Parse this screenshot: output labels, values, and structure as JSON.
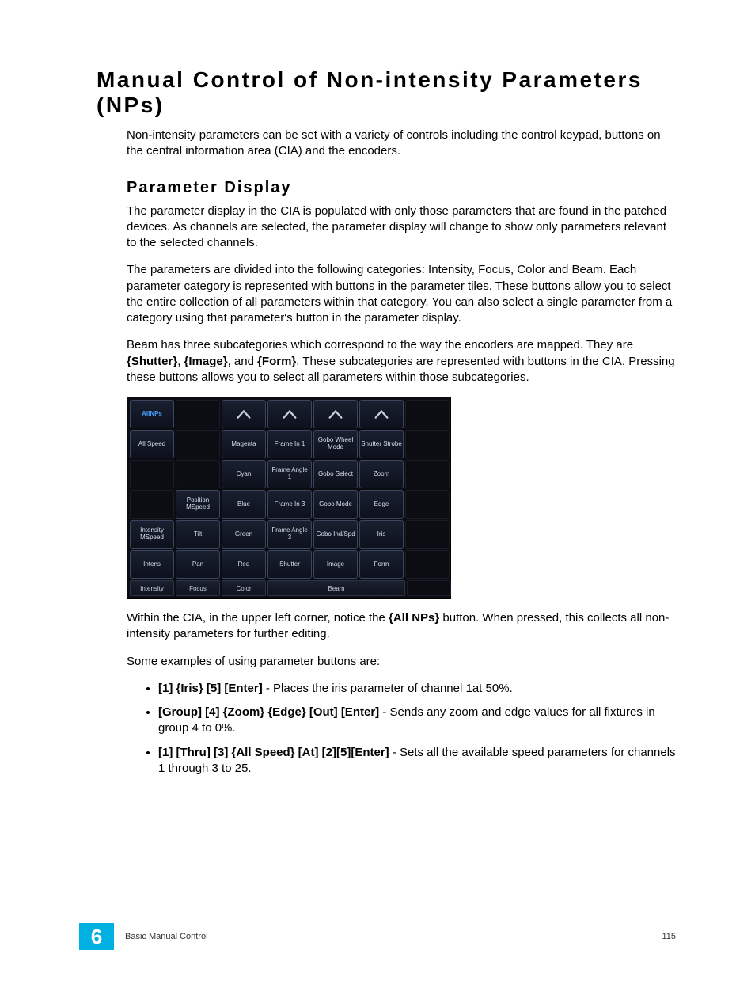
{
  "title": "Manual Control of Non-intensity Parameters (NPs)",
  "intro": "Non-intensity parameters can be set with a variety of controls including the control keypad, buttons on the central information area (CIA) and the encoders.",
  "subheading": "Parameter Display",
  "para1": "The parameter display in the CIA is populated with only those parameters that are found in the patched devices. As channels are selected, the parameter display will change to show only parameters relevant to the selected channels.",
  "para2": "The parameters are divided into the following categories: Intensity, Focus, Color and Beam. Each parameter category is represented with buttons in the parameter tiles. These buttons allow you to select the entire collection of all parameters within that category. You can also select a single parameter from a category using that parameter's button in the parameter display.",
  "para3_a": "Beam has three subcategories which correspond to the way the encoders are mapped. They are ",
  "para3_b1": "{Shutter}",
  "para3_b2": "{Image}",
  "para3_b3": "{Form}",
  "para3_sep": ", ",
  "para3_and": ", and ",
  "para3_c": ". These subcategories are represented with buttons in the CIA. Pressing these buttons allows you to select all parameters within those subcategories.",
  "para4_a": "Within the CIA, in the upper left corner, notice the ",
  "para4_b": "{All NPs}",
  "para4_c": " button. When pressed, this collects all non-intensity parameters for further editing.",
  "para5": "Some examples of using parameter buttons are:",
  "ex1_b": "[1] {Iris} [5] [Enter]",
  "ex1_t": " - Places the iris parameter of channel 1at 50%.",
  "ex2_b": "[Group] [4] {Zoom} {Edge} [Out] [Enter]",
  "ex2_t": " - Sends any zoom and edge values for all fixtures in group 4 to 0%.",
  "ex3_b": "[1] [Thru] [3] {All Speed} [At] [2][5][Enter]",
  "ex3_t": " - Sets all the available speed parameters for channels 1 through 3 to 25.",
  "cia": {
    "r0": [
      "AllNPs",
      "",
      "arrow",
      "arrow",
      "arrow",
      "arrow",
      ""
    ],
    "r1": [
      "All Speed",
      "",
      "Magenta",
      "Frame In 1",
      "Gobo Wheel Mode",
      "Shutter Strobe",
      ""
    ],
    "r2": [
      "",
      "",
      "Cyan",
      "Frame Angle 1",
      "Gobo Select",
      "Zoom",
      ""
    ],
    "r3": [
      "",
      "Position MSpeed",
      "Blue",
      "Frame In 3",
      "Gobo Mode",
      "Edge",
      ""
    ],
    "r4": [
      "Intensity MSpeed",
      "Tilt",
      "Green",
      "Frame Angle 3",
      "Gobo Ind/Spd",
      "Iris",
      ""
    ],
    "r5": [
      "Intens",
      "Pan",
      "Red",
      "Shutter",
      "Image",
      "Form",
      ""
    ],
    "cats": [
      "Intensity",
      "Focus",
      "Color",
      "Beam",
      ""
    ]
  },
  "footer": {
    "chapter": "6",
    "section": "Basic Manual Control",
    "page": "115"
  }
}
